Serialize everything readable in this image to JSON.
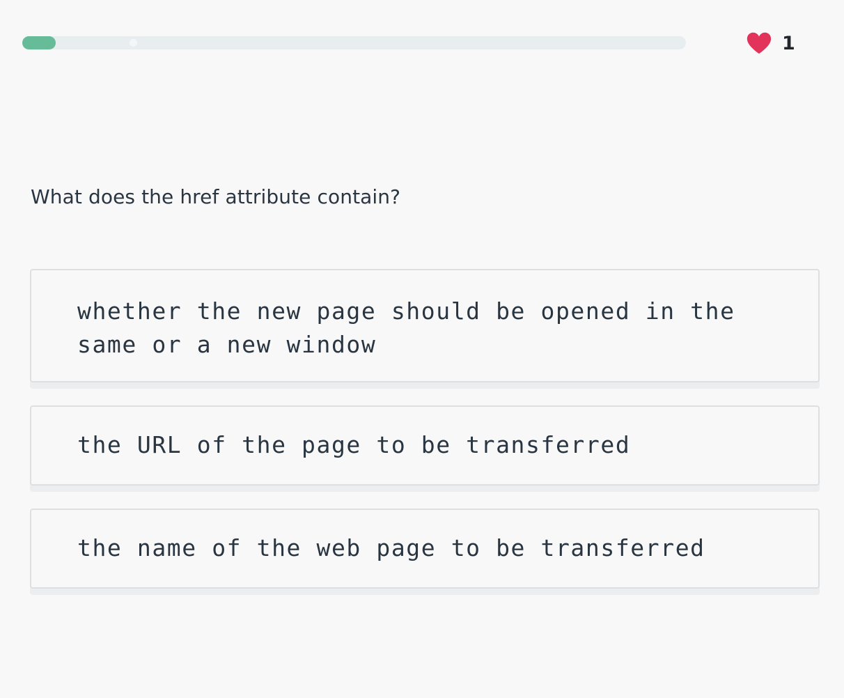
{
  "progress": {
    "fraction": 0.05,
    "fill_color": "#66bb98",
    "track_color": "#e8eef0"
  },
  "lives": {
    "icon": "heart-icon",
    "count": "1",
    "color": "#e2335a"
  },
  "question": {
    "text": "What does the href attribute contain?"
  },
  "options": [
    {
      "text": "whether the new page should be opened in the same or a new window"
    },
    {
      "text": "the URL of the page to be transferred"
    },
    {
      "text": "the name of the web page to be transferred"
    }
  ]
}
